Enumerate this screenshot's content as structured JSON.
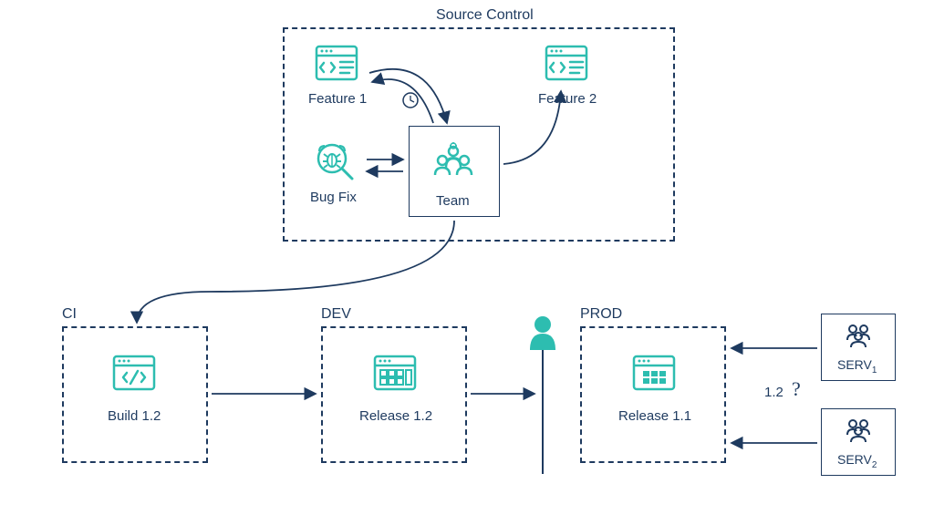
{
  "sections": {
    "source_control": "Source Control",
    "feature1": "Feature 1",
    "feature2": "Feature 2",
    "bugfix": "Bug Fix",
    "team": "Team",
    "ci": "CI",
    "dev": "DEV",
    "prod": "PROD",
    "build": "Build 1.2",
    "release_dev": "Release 1.2",
    "release_prod": "Release 1.1",
    "serv1": "SERV",
    "serv1_sub": "1",
    "serv2": "SERV",
    "serv2_sub": "2",
    "pending_version": "1.2",
    "question": "?"
  }
}
